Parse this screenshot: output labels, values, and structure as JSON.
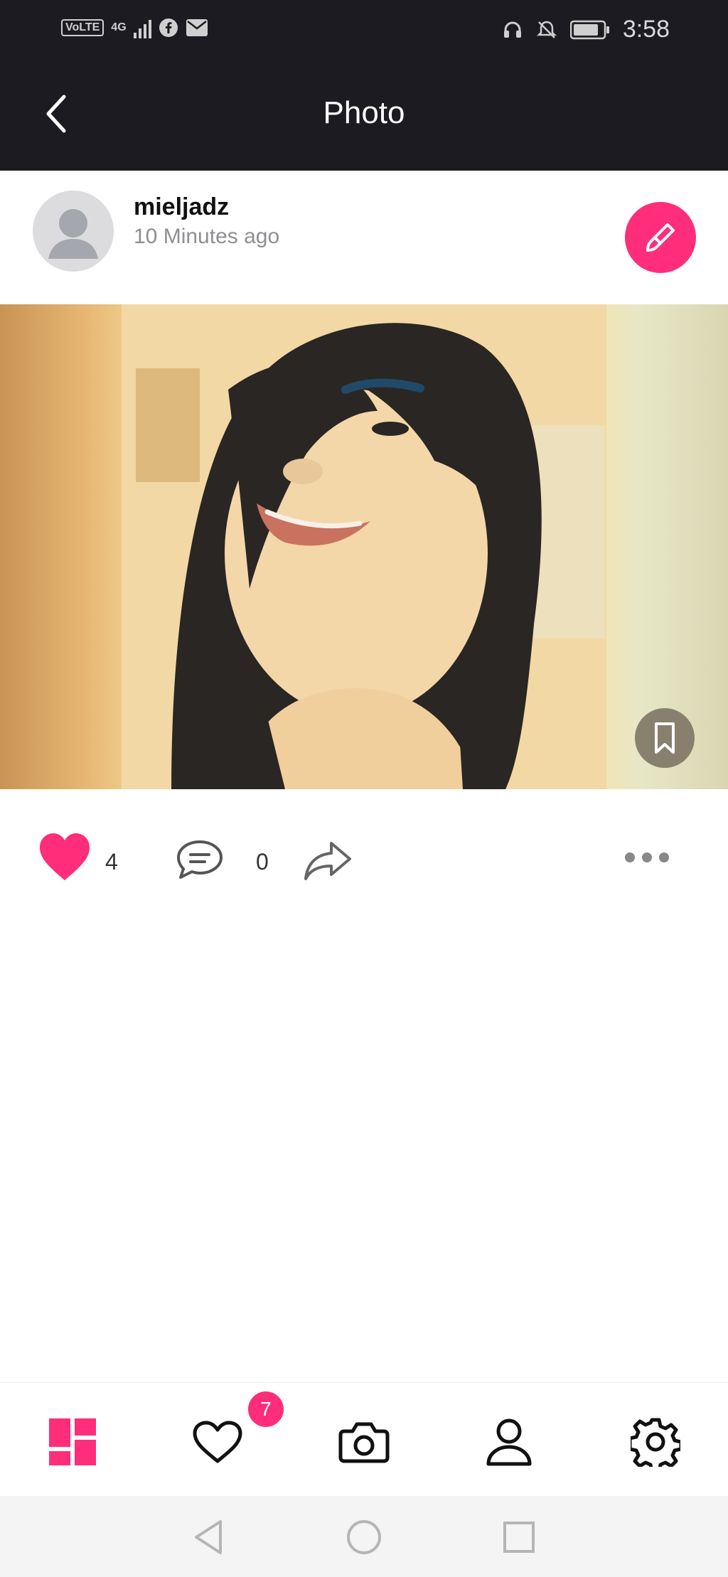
{
  "status_bar": {
    "volte": "VoLTE",
    "network": "4G",
    "time": "3:58",
    "icons": [
      "signal-icon",
      "facebook-icon",
      "mail-icon",
      "headset-icon",
      "mute-icon",
      "battery-icon"
    ]
  },
  "header": {
    "title": "Photo"
  },
  "post": {
    "username": "mieljadz",
    "time_ago": "10 Minutes ago",
    "likes": "4",
    "comments": "0"
  },
  "nav": {
    "items": [
      "feed-icon",
      "favorites-icon",
      "camera-icon",
      "profile-icon",
      "settings-icon"
    ],
    "favorites_badge": "7"
  },
  "colors": {
    "accent": "#ff2d7a",
    "top_bar": "#1d1b22",
    "muted_text": "#8e8e93"
  }
}
